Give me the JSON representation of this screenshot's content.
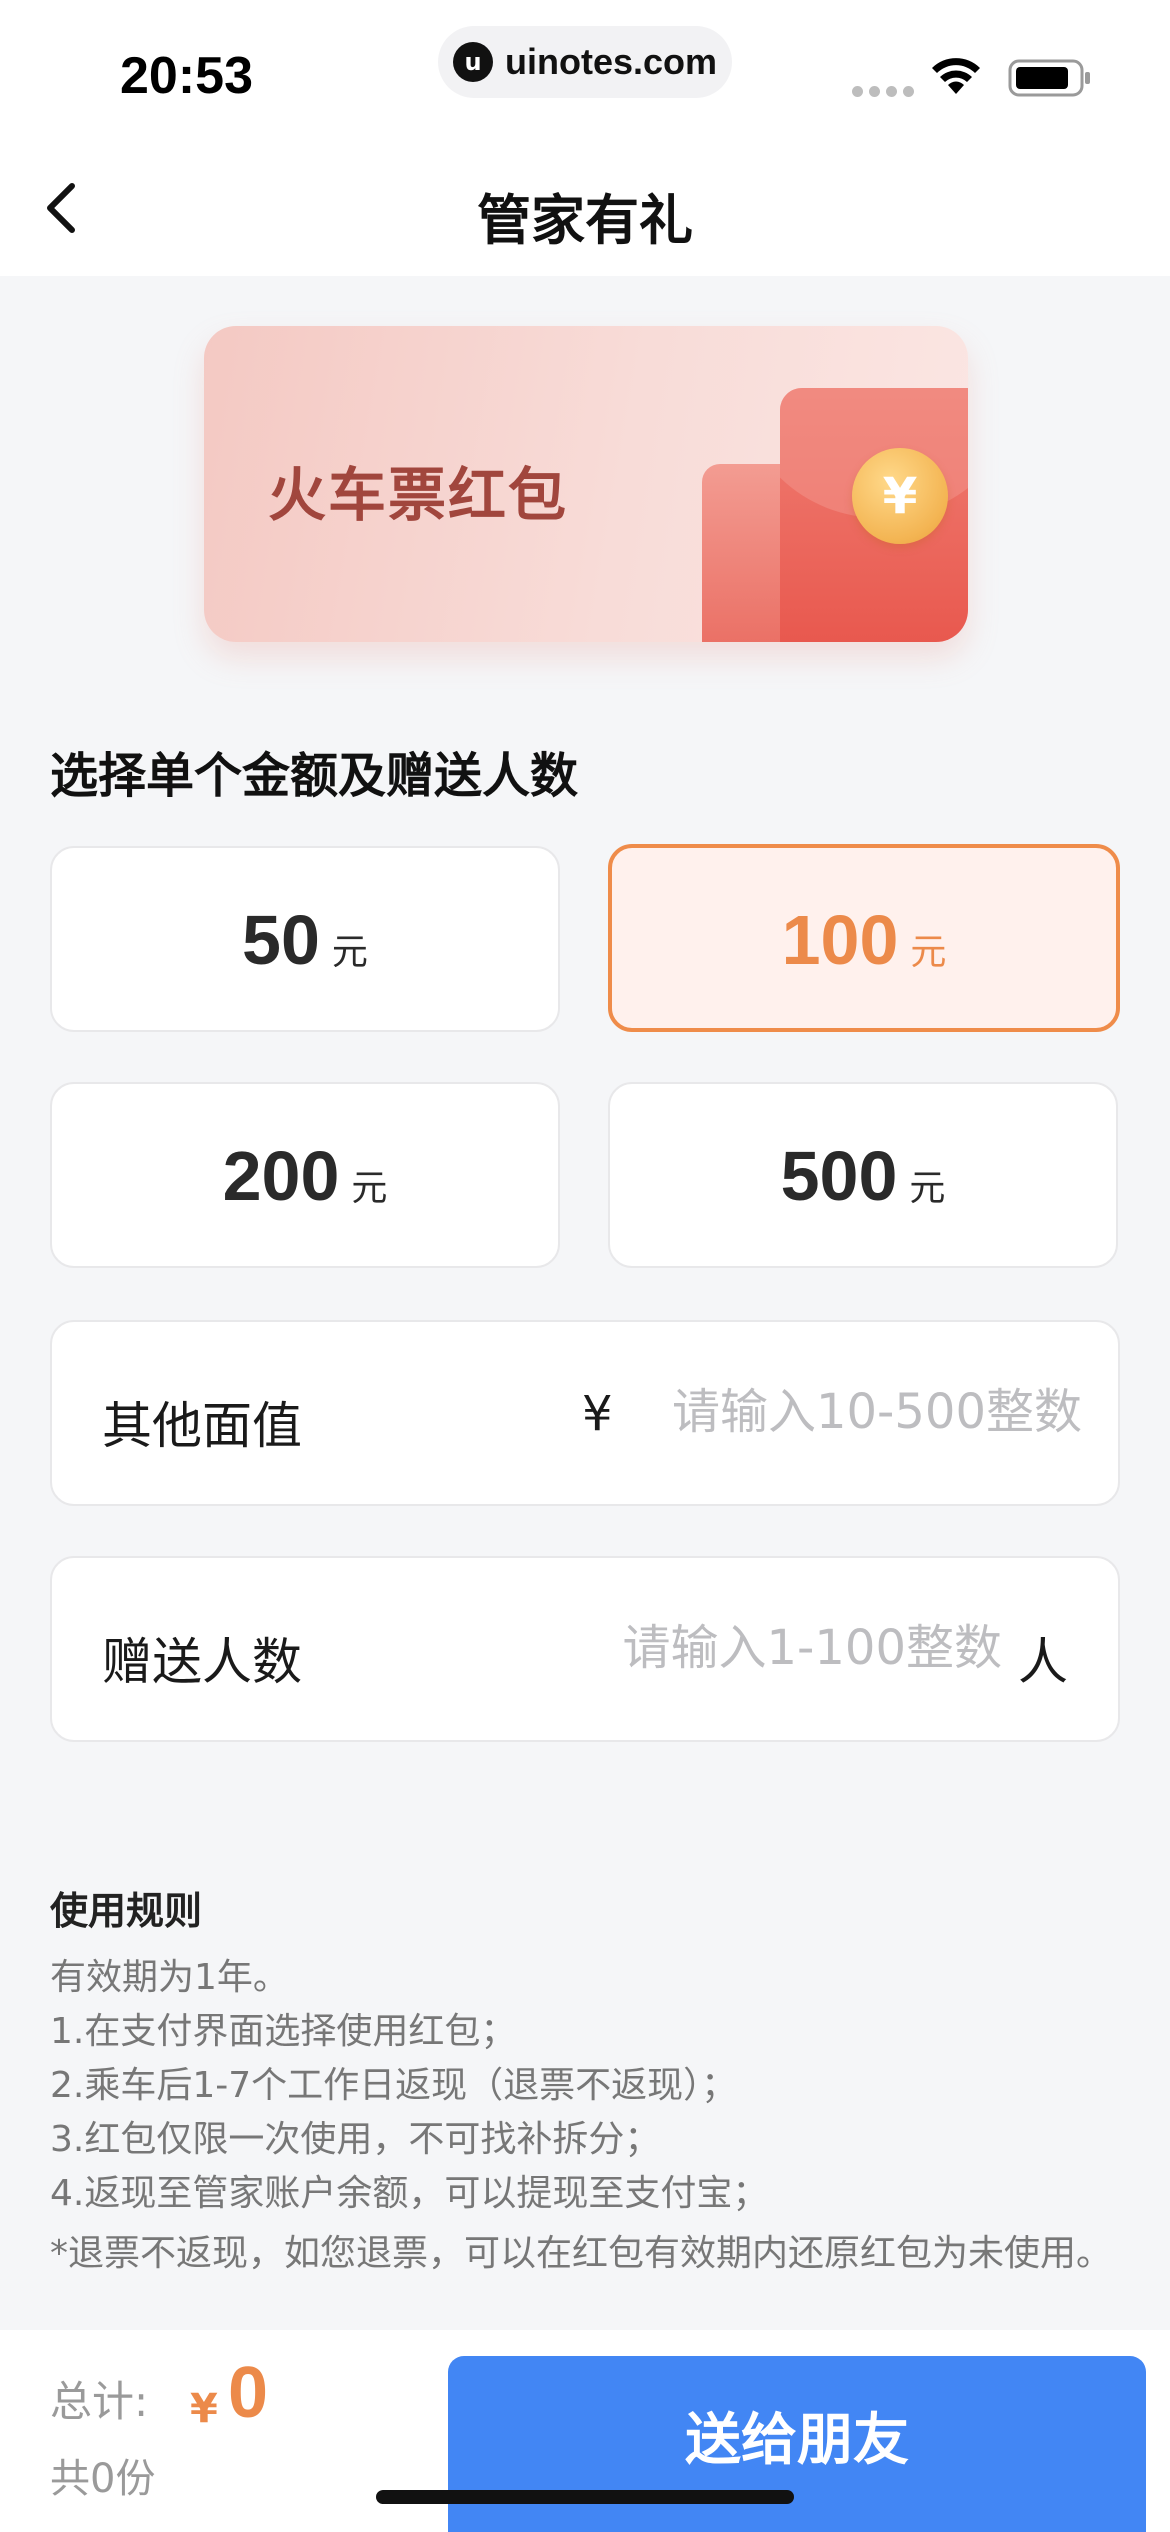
{
  "status_bar": {
    "time": "20:53",
    "url": "uinotes.com"
  },
  "nav": {
    "title": "管家有礼"
  },
  "banner": {
    "title": "火车票红包",
    "coin_symbol": "¥"
  },
  "section": {
    "label": "选择单个金额及赠送人数"
  },
  "amount_options": [
    {
      "value": "50",
      "unit": "元",
      "selected": false
    },
    {
      "value": "100",
      "unit": "元",
      "selected": true
    },
    {
      "value": "200",
      "unit": "元",
      "selected": false
    },
    {
      "value": "500",
      "unit": "元",
      "selected": false
    }
  ],
  "custom_amount": {
    "label": "其他面值",
    "currency": "¥",
    "placeholder": "请输入10-500整数",
    "value": ""
  },
  "recipients": {
    "label": "赠送人数",
    "placeholder": "请输入1-100整数",
    "unit": "人",
    "value": ""
  },
  "rules": {
    "title": "使用规则",
    "lines": [
      "有效期为1年。",
      "1.在支付界面选择使用红包；",
      "2.乘车后1-7个工作日返现（退票不返现）；",
      "3.红包仅限一次使用，不可找补拆分；",
      "4.返现至管家账户余额，可以提现至支付宝；"
    ],
    "note": "*退票不返现，如您退票，可以在红包有效期内还原红包为未使用。"
  },
  "footer": {
    "total_label": "总计:",
    "currency": "¥",
    "total_amount": "0",
    "count_label": "共0份",
    "send_button": "送给朋友"
  },
  "colors": {
    "accent_orange": "#ec8a4a",
    "button_blue": "#4286f4",
    "background": "#f5f6f8"
  },
  "icons": [
    "back-icon",
    "wifi-icon",
    "battery-icon",
    "signal-icon",
    "yen-coin-icon"
  ]
}
